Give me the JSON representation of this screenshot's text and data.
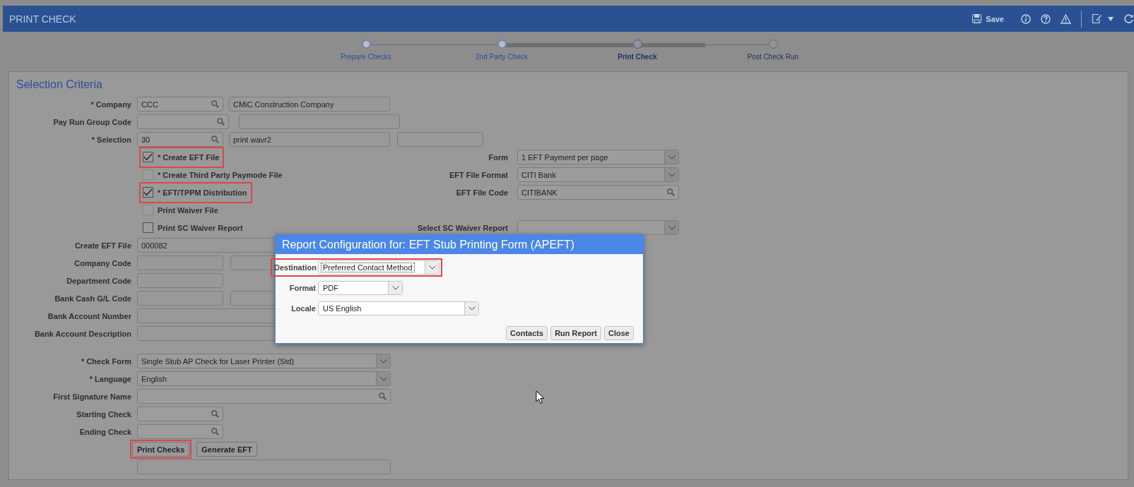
{
  "header": {
    "title": "PRINT CHECK",
    "save_label": "Save"
  },
  "steps": [
    {
      "label": "Prepare Checks",
      "completed": true,
      "selected": false
    },
    {
      "label": "2nd Party Check",
      "completed": true,
      "selected": false
    },
    {
      "label": "Print Check",
      "completed": false,
      "selected": true
    },
    {
      "label": "Post Check Run",
      "completed": false,
      "selected": false
    }
  ],
  "panel_title": "Selection Criteria",
  "rows": [
    {
      "label": "* Company",
      "fields": [
        {
          "kind": "lookup",
          "value": "CCC"
        },
        {
          "kind": "text",
          "value": "CMiC Construction Company"
        }
      ]
    },
    {
      "label": "Pay Run Group Code",
      "fields": [
        {
          "kind": "lookup"
        },
        {
          "kind": "text"
        }
      ]
    },
    {
      "label": "* Selection",
      "fields": [
        {
          "kind": "lookup",
          "value": "30"
        },
        {
          "kind": "text",
          "value": "print wavr2"
        },
        {
          "kind": "text"
        }
      ]
    },
    {
      "checkbox": {
        "label": "* Create EFT File",
        "checked": true,
        "disabled": false,
        "highlighted": true
      },
      "right": {
        "label": "Form",
        "field": {
          "kind": "select",
          "value": "1 EFT Payment per page"
        }
      }
    },
    {
      "checkbox": {
        "label": "* Create Third Party Paymode File",
        "checked": false,
        "disabled": true,
        "highlighted": false
      },
      "right": {
        "label": "EFT File Format",
        "field": {
          "kind": "select",
          "value": "CITI Bank"
        }
      }
    },
    {
      "checkbox": {
        "label": "* EFT/TPPM Distribution",
        "checked": true,
        "disabled": false,
        "highlighted": true
      },
      "right": {
        "label": "EFT File Code",
        "field": {
          "kind": "lookup",
          "value": "CITIBANK"
        }
      }
    },
    {
      "checkbox": {
        "label": "Print Waiver File",
        "checked": false,
        "disabled": true,
        "highlighted": false
      }
    },
    {
      "checkbox": {
        "label": "Print SC Waiver Report",
        "checked": false,
        "disabled": false,
        "highlighted": false
      },
      "right": {
        "label": "Select SC Waiver Report",
        "field": {
          "kind": "select"
        }
      }
    },
    {
      "label": "Create EFT File",
      "fields": [
        {
          "kind": "text",
          "value": "000082"
        }
      ]
    },
    {
      "label": "Company Code",
      "fields": [
        {
          "kind": "text"
        },
        {
          "kind": "text"
        }
      ]
    },
    {
      "label": "Department Code",
      "fields": [
        {
          "kind": "text"
        }
      ]
    },
    {
      "label": "Bank Cash G/L Code",
      "fields": [
        {
          "kind": "text"
        },
        {
          "kind": "text"
        }
      ]
    },
    {
      "label": "Bank Account Number",
      "fields": [
        {
          "kind": "text"
        }
      ]
    },
    {
      "label": "Bank Account Description",
      "fields": [
        {
          "kind": "text"
        }
      ]
    },
    {
      "label": "* Check Form",
      "fields": [
        {
          "kind": "select",
          "value": "Single Stub AP Check for Laser Printer (Std)"
        }
      ]
    },
    {
      "label": "* Language",
      "fields": [
        {
          "kind": "select",
          "value": "English"
        }
      ]
    },
    {
      "label": "First Signature Name",
      "fields": [
        {
          "kind": "lookup"
        }
      ]
    },
    {
      "label": "Starting Check",
      "fields": [
        {
          "kind": "lookup"
        }
      ]
    },
    {
      "label": "Ending Check",
      "fields": [
        {
          "kind": "lookup"
        }
      ]
    },
    {
      "buttons": [
        {
          "label": "Print Checks",
          "highlighted": true
        },
        {
          "label": "Generate EFT",
          "highlighted": false
        }
      ]
    },
    {
      "fields": [
        {
          "kind": "text"
        }
      ]
    }
  ],
  "dialog": {
    "title": "Report Configuration for: EFT Stub Printing Form (APEFT)",
    "rows": [
      {
        "label": "Destination",
        "value": "Preferred Contact Method",
        "focused": true,
        "highlighted": true
      },
      {
        "label": "Format",
        "value": "PDF",
        "focused": false,
        "highlighted": false
      },
      {
        "label": "Locale",
        "value": "US English",
        "focused": false,
        "highlighted": false
      }
    ],
    "buttons": [
      "Contacts",
      "Run Report",
      "Close"
    ]
  }
}
